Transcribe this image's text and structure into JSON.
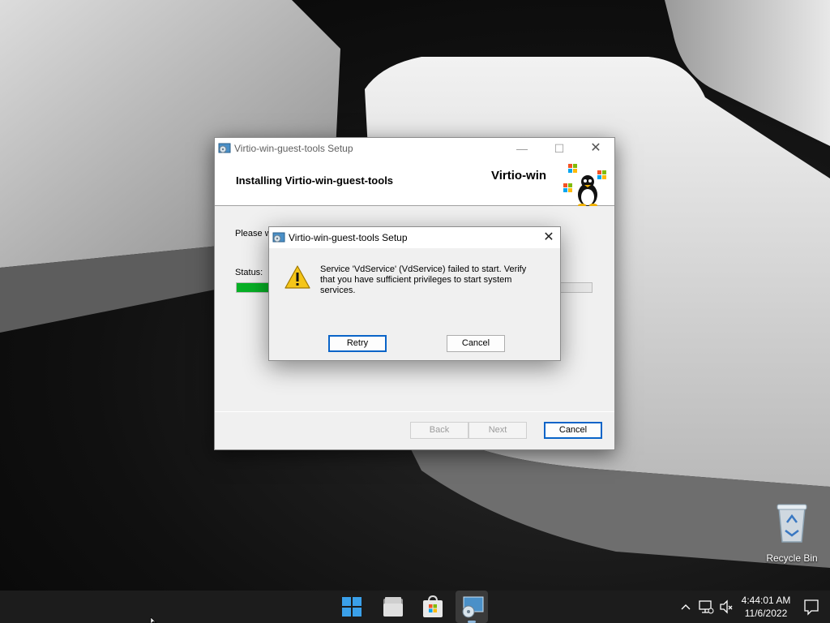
{
  "desktop": {
    "recycle_bin_label": "Recycle Bin"
  },
  "installer": {
    "title": "Virtio-win-guest-tools Setup",
    "heading": "Installing Virtio-win-guest-tools",
    "brand": "Virtio-win",
    "body_text": "Please w",
    "status_label": "Status:",
    "progress": 0.1,
    "back_label": "Back",
    "next_label": "Next",
    "cancel_label": "Cancel"
  },
  "error_dialog": {
    "title": "Virtio-win-guest-tools Setup",
    "message": "Service 'VdService' (VdService) failed to start.  Verify that you have sufficient privileges to start system services.",
    "retry_label": "Retry",
    "cancel_label": "Cancel"
  },
  "taskbar": {
    "items": [
      "start-icon",
      "file-explorer-icon",
      "store-icon",
      "setup-app-icon"
    ],
    "active": "setup-app-icon"
  },
  "tray": {
    "time": "4:44:01 AM",
    "date": "11/6/2022"
  },
  "colors": {
    "progress": "#06b025",
    "default_button_border": "#0a64c8",
    "taskbar": "#1c1c1c"
  }
}
